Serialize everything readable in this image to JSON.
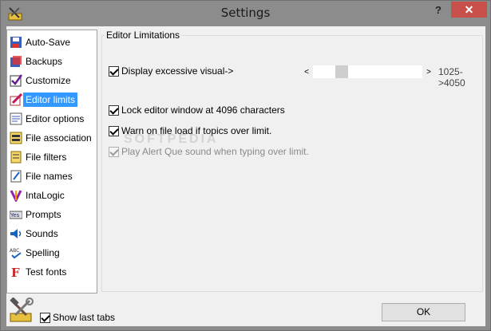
{
  "window": {
    "title": "Settings",
    "help_label": "?",
    "close_label": "✕"
  },
  "sidebar": {
    "items": [
      {
        "label": "Auto-Save",
        "icon": "floppy-save-icon"
      },
      {
        "label": "Backups",
        "icon": "backup-icon"
      },
      {
        "label": "Customize",
        "icon": "checkmark-icon"
      },
      {
        "label": "Editor limits",
        "icon": "pencil-limit-icon",
        "selected": true
      },
      {
        "label": "Editor options",
        "icon": "editor-options-icon"
      },
      {
        "label": "File association",
        "icon": "file-association-icon"
      },
      {
        "label": "File filters",
        "icon": "file-filter-icon"
      },
      {
        "label": "File names",
        "icon": "file-names-icon"
      },
      {
        "label": "IntaLogic",
        "icon": "intalogic-icon"
      },
      {
        "label": "Prompts",
        "icon": "prompts-icon"
      },
      {
        "label": "Sounds",
        "icon": "speaker-icon"
      },
      {
        "label": "Spelling",
        "icon": "spelling-icon"
      },
      {
        "label": "Test fonts",
        "icon": "font-icon"
      }
    ]
  },
  "panel": {
    "group_title": "Editor Limitations",
    "display_visual_label": "Display excessive visual->",
    "slider": {
      "left_arrow": "<",
      "right_arrow": ">",
      "value_text": "1025->4050"
    },
    "lock_label": "Lock editor window at 4096 characters",
    "warn_label": "Warn on file load if topics over limit.",
    "play_alert_label": "Play Alert Que sound when typing over limit.",
    "watermark": "SOFTPEDIA"
  },
  "footer": {
    "show_last_tabs_label": "Show last tabs",
    "ok_label": "OK"
  },
  "colors": {
    "titlebar": "#8c8c8c",
    "close": "#c7504b",
    "selection": "#3399ff"
  }
}
